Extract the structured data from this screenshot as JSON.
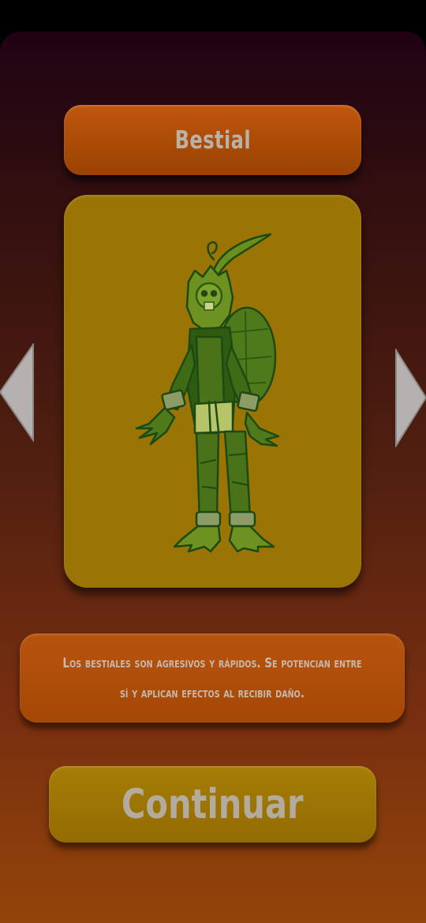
{
  "class_selector": {
    "title": "Bestial",
    "description": "Los bestiales son agresivos y rápidos. Se potencian entre sí y aplican efectos al recibir daño.",
    "character_image": "turtle-plant-beast-character",
    "prev_arrow_icon": "triangle-left-icon",
    "next_arrow_icon": "triangle-right-icon"
  },
  "continue_label": "Continuar",
  "colors": {
    "title_button": "#a84a06",
    "card_background": "#9a7404",
    "continue_button": "#9a7204",
    "arrow": "#b5b1b0",
    "text": "#bdb5aa"
  }
}
